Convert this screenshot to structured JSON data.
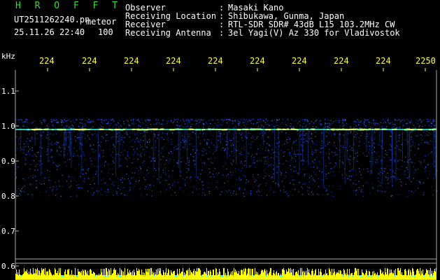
{
  "header": {
    "title": "H R O F F T",
    "filename": "UT2511262240.pn",
    "mode": "meteor",
    "datetime": "25.11.26 22:40",
    "count": "100"
  },
  "info": [
    {
      "label": "Observer",
      "value": "Masaki Kano"
    },
    {
      "label": "Receiving Location",
      "value": "Shibukawa, Gunma, Japan"
    },
    {
      "label": "Receiver",
      "value": "RTL-SDR SDR# 43dB L15 103.2MHz CW"
    },
    {
      "label": "Receiving Antenna",
      "value": "3el Yagi(V) Az 330 for Vladivostok"
    }
  ],
  "chart_data": {
    "type": "heatmap",
    "ylabel": "kHz",
    "x_tick_labels": [
      "224",
      "224",
      "224",
      "224",
      "224",
      "224",
      "224",
      "224",
      "224",
      "2250"
    ],
    "y_tick_labels": [
      "1.1",
      "1.0",
      "0.9",
      "0.8",
      "0.7",
      "0.6"
    ],
    "y_ticks": [
      1.1,
      1.0,
      0.9,
      0.8,
      0.7,
      0.6
    ],
    "ylim": [
      0.6,
      1.1
    ],
    "carrier_khz": 0.99,
    "noise_band_khz": [
      0.8,
      1.02
    ],
    "colors": {
      "background": "#000000",
      "noise": "#1a3fcc",
      "carrier": "#7fffa0",
      "bars": "#ffff00",
      "baseline": "#00ffff",
      "grid": "#aaaaaa"
    }
  }
}
